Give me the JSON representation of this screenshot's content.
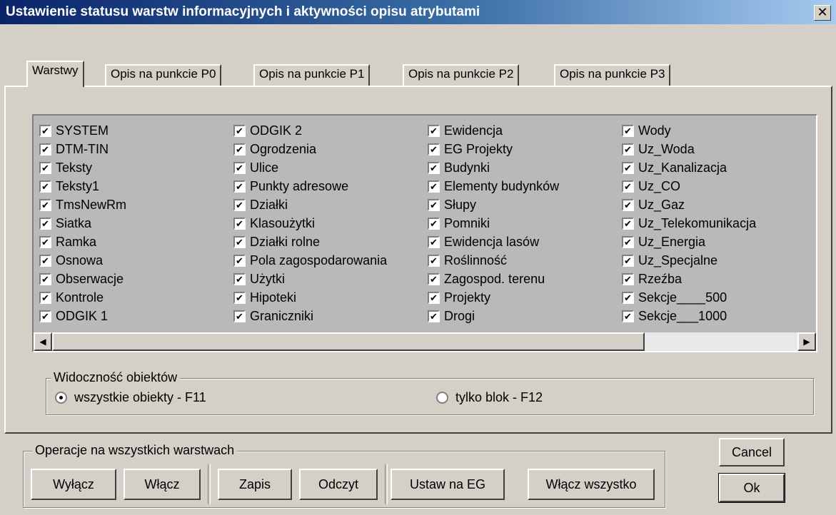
{
  "window": {
    "title": "Ustawienie statusu warstw informacyjnych i aktywności opisu atrybutami",
    "close_label": "✕"
  },
  "tabs": [
    {
      "label": "Warstwy",
      "active": true
    },
    {
      "label": "Opis na punkcie P0"
    },
    {
      "label": "Opis na punkcie P1"
    },
    {
      "label": "Opis na punkcie P2"
    },
    {
      "label": "Opis na punkcie P3"
    }
  ],
  "layers": {
    "check_mark": "✔",
    "columns": [
      [
        "SYSTEM",
        "DTM-TIN",
        "Teksty",
        "Teksty1",
        "TmsNewRm",
        "Siatka",
        "Ramka",
        "Osnowa",
        "Obserwacje",
        "Kontrole",
        "ODGIK 1"
      ],
      [
        "ODGIK 2",
        "Ogrodzenia",
        "Ulice",
        "Punkty adresowe",
        "Działki",
        "Klasoużytki",
        "Działki rolne",
        "Pola zagospodarowania",
        "Użytki",
        "Hipoteki",
        "Graniczniki"
      ],
      [
        "Ewidencja",
        "EG Projekty",
        "Budynki",
        "Elementy budynków",
        "Słupy",
        "Pomniki",
        "Ewidencja lasów",
        "Roślinność",
        "Zagospod. terenu",
        "Projekty",
        "Drogi"
      ],
      [
        "Wody",
        "Uz_Woda",
        "Uz_Kanalizacja",
        "Uz_CO",
        "Uz_Gaz",
        "Uz_Telekomunikacja",
        "Uz_Energia",
        "Uz_Specjalne",
        "Rzeźba",
        "Sekcje____500",
        "Sekcje___1000"
      ]
    ]
  },
  "scrollbar": {
    "left_arrow": "◀",
    "right_arrow": "▶"
  },
  "visibility": {
    "title": "Widoczność obiektów",
    "option_all": "wszystkie obiekty  - F11",
    "option_block": "tylko blok - F12",
    "selected": "all"
  },
  "operations": {
    "title": "Operacje na wszystkich warstwach",
    "off": "Wyłącz",
    "on": "Włącz",
    "save": "Zapis",
    "load": "Odczyt",
    "set_eg": "Ustaw na EG",
    "enable_all": "Włącz wszystko"
  },
  "dialog": {
    "cancel": "Cancel",
    "ok": "Ok"
  }
}
